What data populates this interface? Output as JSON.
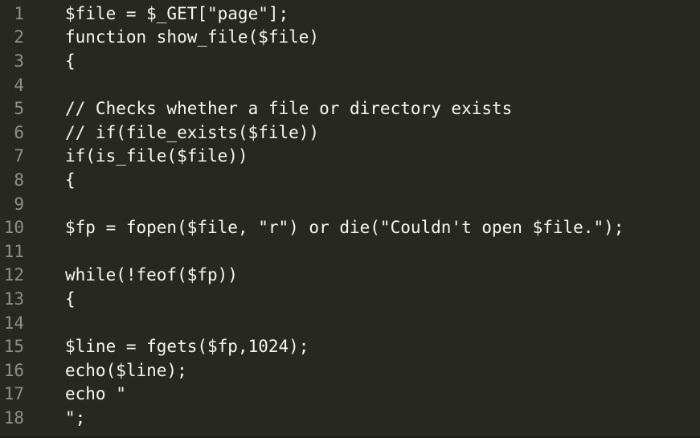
{
  "editor": {
    "lines": [
      {
        "number": "1",
        "text": "$file = $_GET[\"page\"];"
      },
      {
        "number": "2",
        "text": "function show_file($file)"
      },
      {
        "number": "3",
        "text": "{"
      },
      {
        "number": "4",
        "text": ""
      },
      {
        "number": "5",
        "text": "// Checks whether a file or directory exists"
      },
      {
        "number": "6",
        "text": "// if(file_exists($file))"
      },
      {
        "number": "7",
        "text": "if(is_file($file))"
      },
      {
        "number": "8",
        "text": "{"
      },
      {
        "number": "9",
        "text": ""
      },
      {
        "number": "10",
        "text": "$fp = fopen($file, \"r\") or die(\"Couldn't open $file.\");"
      },
      {
        "number": "11",
        "text": ""
      },
      {
        "number": "12",
        "text": "while(!feof($fp))"
      },
      {
        "number": "13",
        "text": "{"
      },
      {
        "number": "14",
        "text": ""
      },
      {
        "number": "15",
        "text": "$line = fgets($fp,1024);"
      },
      {
        "number": "16",
        "text": "echo($line);"
      },
      {
        "number": "17",
        "text": "echo \""
      },
      {
        "number": "18",
        "text": "\";"
      }
    ]
  },
  "colors": {
    "background": "#272822",
    "gutter_text": "#8f908a",
    "code_text": "#f8f8f2"
  }
}
